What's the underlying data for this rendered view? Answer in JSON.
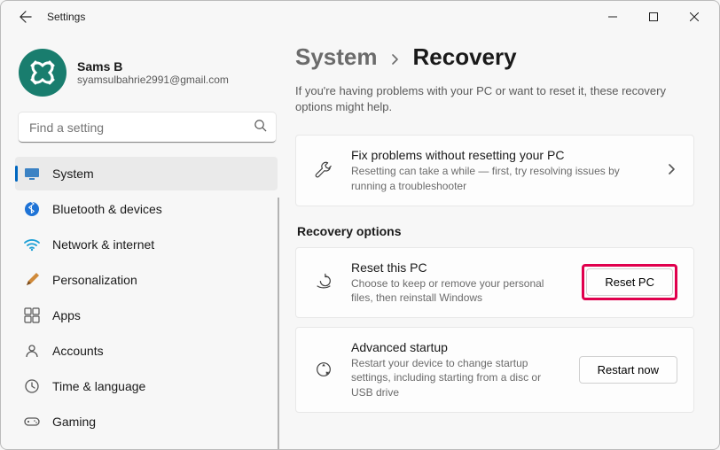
{
  "window": {
    "title": "Settings"
  },
  "profile": {
    "name": "Sams B",
    "email": "syamsulbahrie2991@gmail.com"
  },
  "search": {
    "placeholder": "Find a setting"
  },
  "sidebar": {
    "items": [
      {
        "label": "System",
        "icon": "system",
        "selected": true
      },
      {
        "label": "Bluetooth & devices",
        "icon": "bluetooth",
        "selected": false
      },
      {
        "label": "Network & internet",
        "icon": "wifi",
        "selected": false
      },
      {
        "label": "Personalization",
        "icon": "brush",
        "selected": false
      },
      {
        "label": "Apps",
        "icon": "apps",
        "selected": false
      },
      {
        "label": "Accounts",
        "icon": "accounts",
        "selected": false
      },
      {
        "label": "Time & language",
        "icon": "time",
        "selected": false
      },
      {
        "label": "Gaming",
        "icon": "gaming",
        "selected": false
      }
    ]
  },
  "breadcrumb": {
    "parent": "System",
    "current": "Recovery"
  },
  "intro": "If you're having problems with your PC or want to reset it, these recovery options might help.",
  "fix_card": {
    "title": "Fix problems without resetting your PC",
    "desc": "Resetting can take a while — first, try resolving issues by running a troubleshooter"
  },
  "section_heading": "Recovery options",
  "reset_card": {
    "title": "Reset this PC",
    "desc": "Choose to keep or remove your personal files, then reinstall Windows",
    "button": "Reset PC"
  },
  "advanced_card": {
    "title": "Advanced startup",
    "desc": "Restart your device to change startup settings, including starting from a disc or USB drive",
    "button": "Restart now"
  }
}
